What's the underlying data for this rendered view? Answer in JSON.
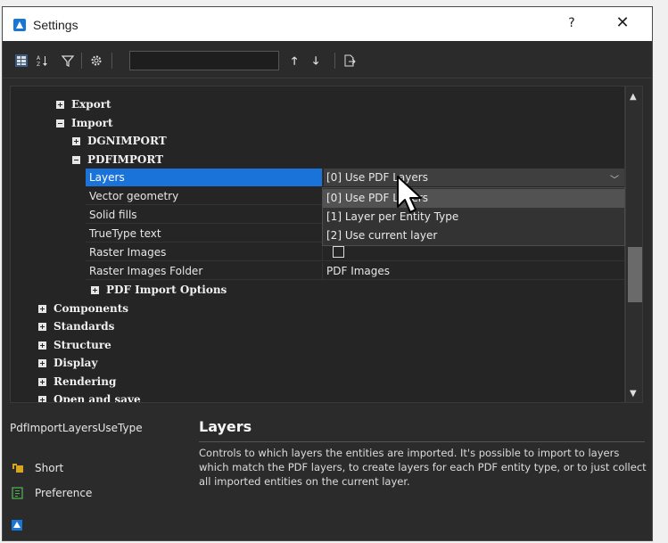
{
  "window": {
    "title": "Settings",
    "help_label": "?",
    "close_label": "✕"
  },
  "toolbar": {
    "search_value": "",
    "up_label": "🡑",
    "down_label": "🡓"
  },
  "tree": {
    "groups": {
      "export": "Export",
      "import": "Import",
      "dgnimport": "DGNIMPORT",
      "pdfimport": "PDFIMPORT",
      "pdf_import_options": "PDF Import Options",
      "components": "Components",
      "standards": "Standards",
      "structure": "Structure",
      "display": "Display",
      "rendering": "Rendering",
      "open_and_save": "Open and save"
    },
    "properties": {
      "layers": {
        "name": "Layers",
        "value": "[0] Use PDF Layers"
      },
      "vector_geometry": {
        "name": "Vector geometry",
        "value": ""
      },
      "solid_fills": {
        "name": "Solid fills",
        "value": ""
      },
      "truetype_text": {
        "name": "TrueType text",
        "value": ""
      },
      "raster_images": {
        "name": "Raster Images",
        "value": ""
      },
      "raster_images_folder": {
        "name": "Raster Images Folder",
        "value": "PDF Images"
      }
    }
  },
  "dropdown": {
    "options": [
      "[0] Use PDF Layers",
      "[1] Layer per Entity Type",
      "[2] Use current layer"
    ],
    "highlighted_index": 0
  },
  "details": {
    "variable": "PdfImportLayersUseType",
    "title": "Layers",
    "description": "Controls to which layers the entities are imported. It's possible to import to layers which match the PDF layers, to create layers for each PDF entity type, or to just collect all imported entities on the current layer.",
    "short_label": "Short",
    "preference_label": "Preference"
  },
  "colors": {
    "selection": "#1a73d9",
    "background": "#2b2b2b",
    "brand": "#1877d6"
  }
}
